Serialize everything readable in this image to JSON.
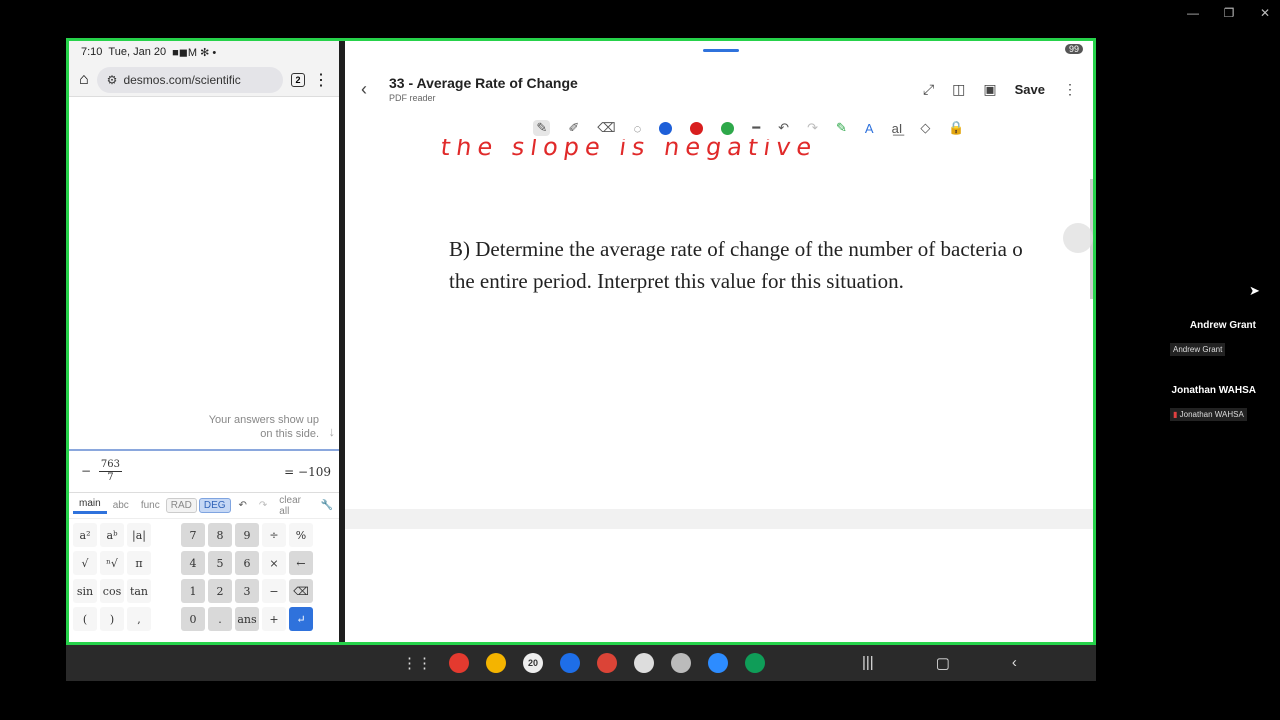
{
  "window_controls": {
    "minimize": "—",
    "restore": "❐",
    "close": "✕"
  },
  "phone_status": {
    "time": "7:10",
    "date": "Tue, Jan 20",
    "icons": "■◼M ✻ •"
  },
  "browser": {
    "url": "desmos.com/scientific",
    "tab_count": "2"
  },
  "desmos": {
    "hint_line1": "Your answers show up",
    "hint_line2": "on this side.",
    "expr_sign": "−",
    "expr_num": "763",
    "expr_den": "7",
    "expr_result": "= −109",
    "tabs": {
      "main": "main",
      "abc": "abc",
      "func": "func",
      "rad": "RAD",
      "deg": "DEG",
      "clear": "clear all"
    },
    "keys_row1": [
      "a²",
      "aᵇ",
      "|a|",
      "",
      "7",
      "8",
      "9",
      "÷",
      "%"
    ],
    "keys_row2": [
      "√",
      "ⁿ√",
      "π",
      "",
      "4",
      "5",
      "6",
      "×",
      "←"
    ],
    "keys_row3": [
      "sin",
      "cos",
      "tan",
      "",
      "1",
      "2",
      "3",
      "−",
      ""
    ],
    "keys_row4": [
      "(",
      ")",
      ",",
      "",
      "0",
      ".",
      "ans",
      "+",
      ""
    ],
    "frac_key": "a/b",
    "right_arrow": "→",
    "backspace": "⌫",
    "enter": "↵"
  },
  "pdf": {
    "title": "33 - Average Rate of Change",
    "subtitle": "PDF reader",
    "save_label": "Save",
    "badge": "99",
    "handwriting": "the slope is negative",
    "question_line1": "B) Determine the average rate of change of the number of bacteria o",
    "question_line2": "the entire period. Interpret this value for this situation.",
    "pen_colors": [
      "#1e5fd8",
      "#d81e1e",
      "#2ea84a"
    ]
  },
  "dock": {
    "calendar_day": "20"
  },
  "participants": [
    {
      "name": "Andrew Grant",
      "tag": "Andrew Grant"
    },
    {
      "name": "Jonathan WAHSA",
      "tag": "Jonathan WAHSA"
    }
  ]
}
